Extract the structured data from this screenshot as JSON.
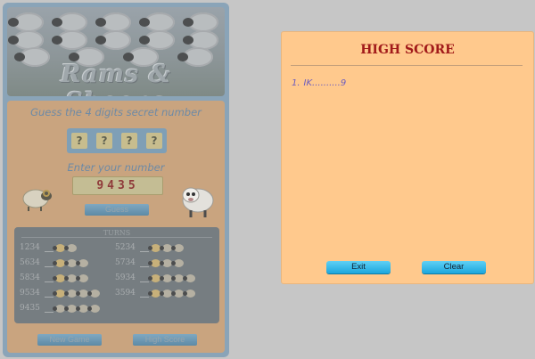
{
  "game": {
    "banner_title": "Rams & Sheeps",
    "guess_prompt": "Guess the 4 digits secret number",
    "secret_digits": [
      "?",
      "?",
      "?",
      "?"
    ],
    "enter_prompt": "Enter your number",
    "current_input": "9435",
    "guess_button": "Guess",
    "turns_title": "TURNS",
    "turns": [
      {
        "number": "1234",
        "rams": 1,
        "sheeps": 1
      },
      {
        "number": "5634",
        "rams": 1,
        "sheeps": 2
      },
      {
        "number": "5834",
        "rams": 1,
        "sheeps": 2
      },
      {
        "number": "9534",
        "rams": 1,
        "sheeps": 3
      },
      {
        "number": "9435",
        "rams": 0,
        "sheeps": 4
      },
      {
        "number": "5234",
        "rams": 1,
        "sheeps": 2
      },
      {
        "number": "5734",
        "rams": 1,
        "sheeps": 2
      },
      {
        "number": "5934",
        "rams": 1,
        "sheeps": 3
      },
      {
        "number": "3594",
        "rams": 1,
        "sheeps": 3
      }
    ],
    "new_game_button": "New Game",
    "high_score_button": "High Score"
  },
  "high_score_dialog": {
    "title": "HIGH SCORE",
    "entries": [
      {
        "rank": "1.",
        "text": "IK..........9"
      }
    ],
    "exit_button": "Exit",
    "clear_button": "Clear"
  }
}
